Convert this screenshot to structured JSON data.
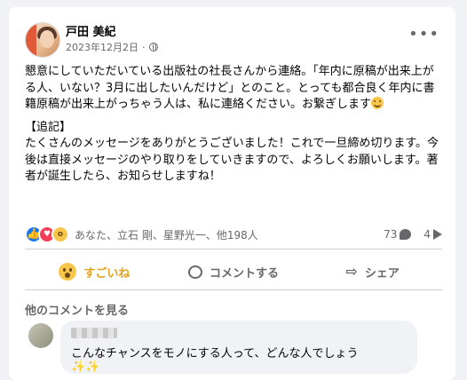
{
  "post": {
    "author": "戸田 美紀",
    "date": "2023年12月2日",
    "separator": "·",
    "more_label": "•••",
    "paragraph1": "懇意にしていただいている出版社の社長さんから連絡。「年内に原稿が出来上がる人、いない？3月に出したいんだけど」とのこと。とっても都合良く年内に書籍原稿が出来上がっちゃう人は、私に連絡ください。お繋ぎします",
    "addendum_heading": "【追記】",
    "paragraph2": "たくさんのメッセージをありがとうございました！これで一旦締め切ります。今後は直接メッセージのやり取りをしていきますので、よろしくお願いします。著者が誕生したら、お知らせしますね！",
    "emoji": "smiling-face"
  },
  "reactions": {
    "types": [
      "like",
      "love",
      "wow"
    ],
    "names": "あなた、立石 剛、星野光一、他198人",
    "comments": "73",
    "shares": "4"
  },
  "actions": {
    "wow": "すごいね",
    "comment": "コメントする",
    "share": "シェア"
  },
  "comments": {
    "see_more": "他のコメントを見る",
    "first_text": "こんなチャンスをモノにする人って、どんな人でしょう",
    "sparkles": "✨✨"
  },
  "colors": {
    "wow_active": "#e5a118",
    "like": "#1877f2",
    "love": "#f33e58",
    "wow": "#f7c64a"
  }
}
